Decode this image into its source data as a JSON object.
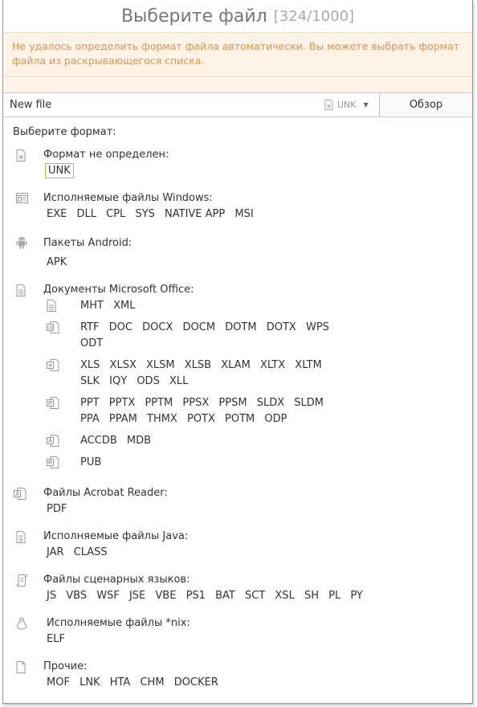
{
  "header": {
    "title": "Выберите файл",
    "counter": "[324/1000]"
  },
  "warning": "Не удалось определить формат файла автоматически. Вы можете выбрать формат файла из раскрывающегося списка.",
  "filebar": {
    "filename": "New file",
    "type_value": "UNK",
    "browse_label": "Обзор"
  },
  "choose_label": "Выберите формат:",
  "groups": {
    "unknown": {
      "title": "Формат не определен:",
      "exts": [
        "UNK"
      ]
    },
    "windows": {
      "title": "Исполняемые файлы Windows:",
      "exts": [
        "EXE",
        "DLL",
        "CPL",
        "SYS",
        "NATIVE APP",
        "MSI"
      ]
    },
    "android": {
      "title": "Пакеты Android:",
      "exts": [
        "APK"
      ]
    },
    "office": {
      "title": "Документы Microsoft Office:",
      "sub": [
        [
          "MHT",
          "XML"
        ],
        [
          "RTF",
          "DOC",
          "DOCX",
          "DOCM",
          "DOTM",
          "DOTX",
          "WPS",
          "ODT"
        ],
        [
          "XLS",
          "XLSX",
          "XLSM",
          "XLSB",
          "XLAM",
          "XLTX",
          "XLTM",
          "SLK",
          "IQY",
          "ODS",
          "XLL"
        ],
        [
          "PPT",
          "PPTX",
          "PPTM",
          "PPSX",
          "PPSM",
          "SLDX",
          "SLDM",
          "PPA",
          "PPAM",
          "THMX",
          "POTX",
          "POTM",
          "ODP"
        ],
        [
          "ACCDB",
          "MDB"
        ],
        [
          "PUB"
        ]
      ]
    },
    "acrobat": {
      "title": "Файлы Acrobat Reader:",
      "exts": [
        "PDF"
      ]
    },
    "java": {
      "title": "Исполняемые файлы Java:",
      "exts": [
        "JAR",
        "CLASS"
      ]
    },
    "script": {
      "title": "Файлы сценарных языков:",
      "exts": [
        "JS",
        "VBS",
        "WSF",
        "JSE",
        "VBE",
        "PS1",
        "BAT",
        "SCT",
        "XSL",
        "SH",
        "PL",
        "PY"
      ]
    },
    "nix": {
      "title": "Исполняемые файлы *nix:",
      "exts": [
        "ELF"
      ]
    },
    "other": {
      "title": "Прочие:",
      "exts": [
        "MOF",
        "LNK",
        "HTA",
        "CHM",
        "DOCKER"
      ]
    }
  },
  "icons": {
    "unknown": "unknown-file-icon",
    "windows": "window-icon",
    "android": "android-icon",
    "office": "document-icon",
    "acrobat": "pdf-icon",
    "java": "java-icon",
    "script": "script-icon",
    "nix": "linux-icon",
    "other": "file-icon"
  },
  "colors": {
    "warning_text": "#e29347",
    "warning_bg": "#fdf3e6",
    "selected_border": "#9bc84b"
  }
}
